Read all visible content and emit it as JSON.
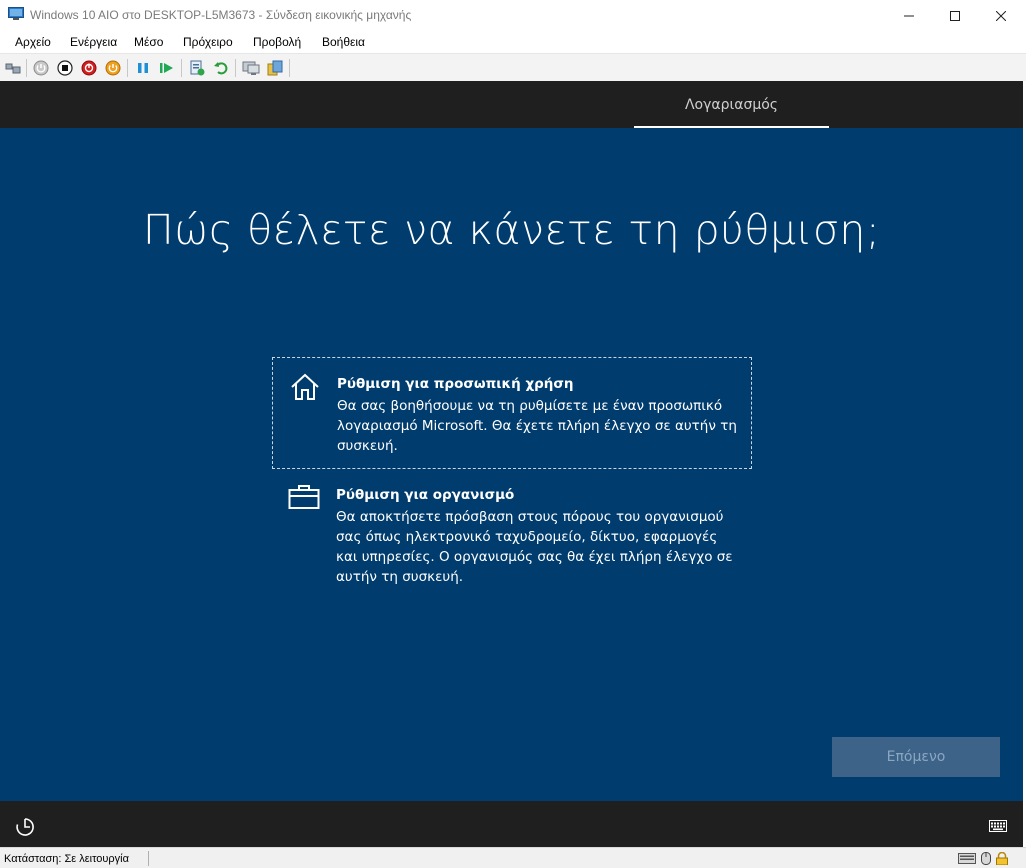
{
  "window": {
    "title": "Windows 10 AIO στο DESKTOP-L5M3673 - Σύνδεση εικονικής μηχανής",
    "app_icon": "vm-connection-icon",
    "controls": [
      "minimize-icon",
      "maximize-icon",
      "close-icon"
    ]
  },
  "menu": {
    "items": [
      "Αρχείο",
      "Ενέργεια",
      "Μέσο",
      "Πρόχειρο",
      "Προβολή",
      "Βοήθεια"
    ]
  },
  "toolbar": {
    "buttons": [
      "ctrl-alt-del-icon",
      "start-icon",
      "turn-off-icon",
      "shut-down-icon",
      "power-icon",
      "pause-icon",
      "resume-icon",
      "checkpoint-icon",
      "revert-icon",
      "enhanced-session-icon",
      "share-icon"
    ]
  },
  "vm": {
    "step_label": "Λογαριασμός",
    "heading": "Πώς θέλετε να κάνετε τη ρύθμιση;",
    "options": [
      {
        "icon": "home-icon",
        "title": "Ρύθμιση για προσωπική χρήση",
        "description": "Θα σας βοηθήσουμε να τη ρυθμίσετε με έναν προσωπικό λογαριασμό Microsoft. Θα έχετε πλήρη έλεγχο σε αυτήν τη συσκευή.",
        "selected": true
      },
      {
        "icon": "briefcase-icon",
        "title": "Ρύθμιση για οργανισμό",
        "description": "Θα αποκτήσετε πρόσβαση στους πόρους του οργανισμού σας όπως ηλεκτρονικό ταχυδρομείο, δίκτυο, εφαρμογές και υπηρεσίες. Ο οργανισμός σας θα έχει πλήρη έλεγχο σε αυτήν τη συσκευή.",
        "selected": false
      }
    ],
    "next_button": "Επόμενο",
    "ease_of_access_icon": "ease-of-access-icon",
    "keyboard_icon": "keyboard-icon"
  },
  "statusbar": {
    "text": "Κατάσταση: Σε λειτουργία",
    "icons": [
      "keyboard-status-icon",
      "mouse-status-icon",
      "lock-status-icon"
    ]
  },
  "colors": {
    "vm_background": "#003c6d",
    "band": "#1f1f1f",
    "next_button_disabled": "#3d6488"
  }
}
